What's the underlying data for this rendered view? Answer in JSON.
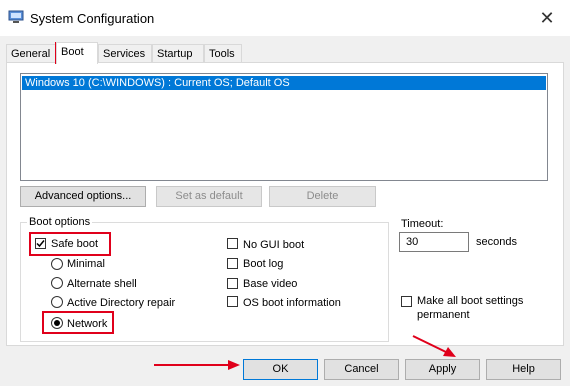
{
  "window": {
    "title": "System Configuration",
    "close_glyph": "✕"
  },
  "tabs": [
    {
      "label": "General"
    },
    {
      "label": "Boot",
      "active": true
    },
    {
      "label": "Services"
    },
    {
      "label": "Startup"
    },
    {
      "label": "Tools"
    }
  ],
  "os_list": {
    "items": [
      "Windows 10 (C:\\WINDOWS) : Current OS; Default OS"
    ],
    "selected_index": 0
  },
  "list_buttons": {
    "advanced": "Advanced options...",
    "set_default": "Set as default",
    "delete": "Delete"
  },
  "boot_options": {
    "group_label": "Boot options",
    "safe_boot": {
      "label": "Safe boot",
      "checked": true
    },
    "radios": [
      {
        "label": "Minimal",
        "selected": false
      },
      {
        "label": "Alternate shell",
        "selected": false
      },
      {
        "label": "Active Directory repair",
        "selected": false
      },
      {
        "label": "Network",
        "selected": true
      }
    ],
    "checkboxes": [
      {
        "label": "No GUI boot",
        "checked": false
      },
      {
        "label": "Boot log",
        "checked": false
      },
      {
        "label": "Base video",
        "checked": false
      },
      {
        "label": "OS boot information",
        "checked": false
      }
    ]
  },
  "timeout": {
    "label": "Timeout:",
    "value": "30",
    "unit": "seconds"
  },
  "make_permanent": {
    "label_line1": "Make all boot settings",
    "label_line2": "permanent",
    "checked": false
  },
  "dialog_buttons": {
    "ok": "OK",
    "cancel": "Cancel",
    "apply": "Apply",
    "help": "Help"
  },
  "colors": {
    "selection": "#0078d7",
    "annotation": "#e0001b"
  }
}
